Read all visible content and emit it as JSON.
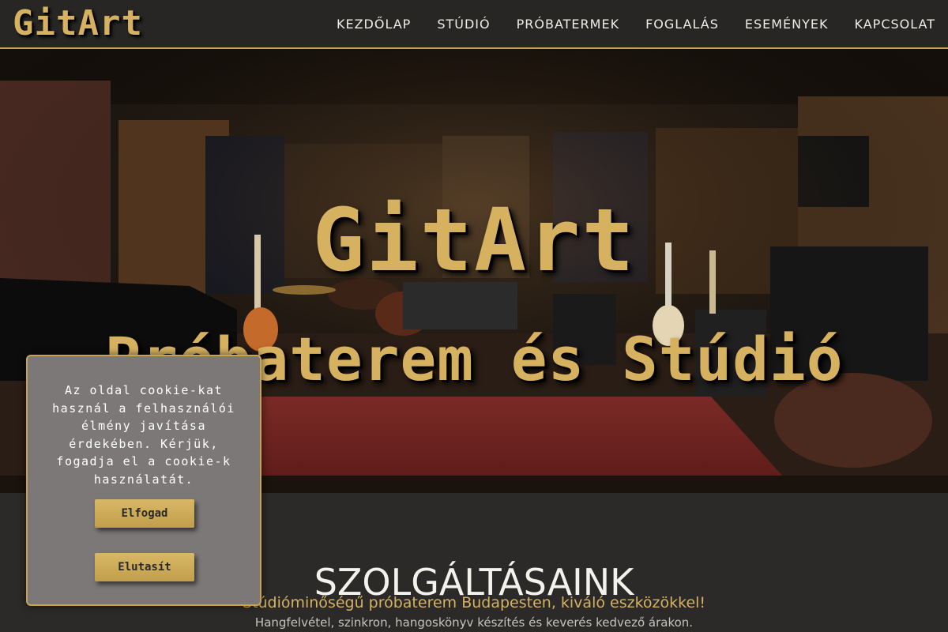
{
  "header": {
    "logo": "GitArt",
    "nav": [
      "KEZDŐLAP",
      "STÚDIÓ",
      "PRÓBATERMEK",
      "FOGLALÁS",
      "ESEMÉNYEK",
      "KAPCSOLAT"
    ]
  },
  "hero": {
    "title": "GitArt",
    "subtitle": "Próbaterem és Stúdió"
  },
  "services": {
    "title": "SZOLGÁLTÁSAINK",
    "subtitle": "Stúdióminőségű próbaterem Budapesten, kiváló eszközökkel!",
    "description": "Hangfelvétel, szinkron, hangoskönyv készítés és keverés kedvező árakon."
  },
  "cookie": {
    "text": "Az oldal cookie-kat használ a felhasználói élmény javítása érdekében. Kérjük, fogadja el a cookie-k használatát.",
    "accept_label": "Elfogad",
    "reject_label": "Elutasít"
  },
  "colors": {
    "accent": "#d6b260",
    "header_bg": "#272625",
    "page_bg": "#2b2a29",
    "cookie_bg": "#7c7877"
  }
}
